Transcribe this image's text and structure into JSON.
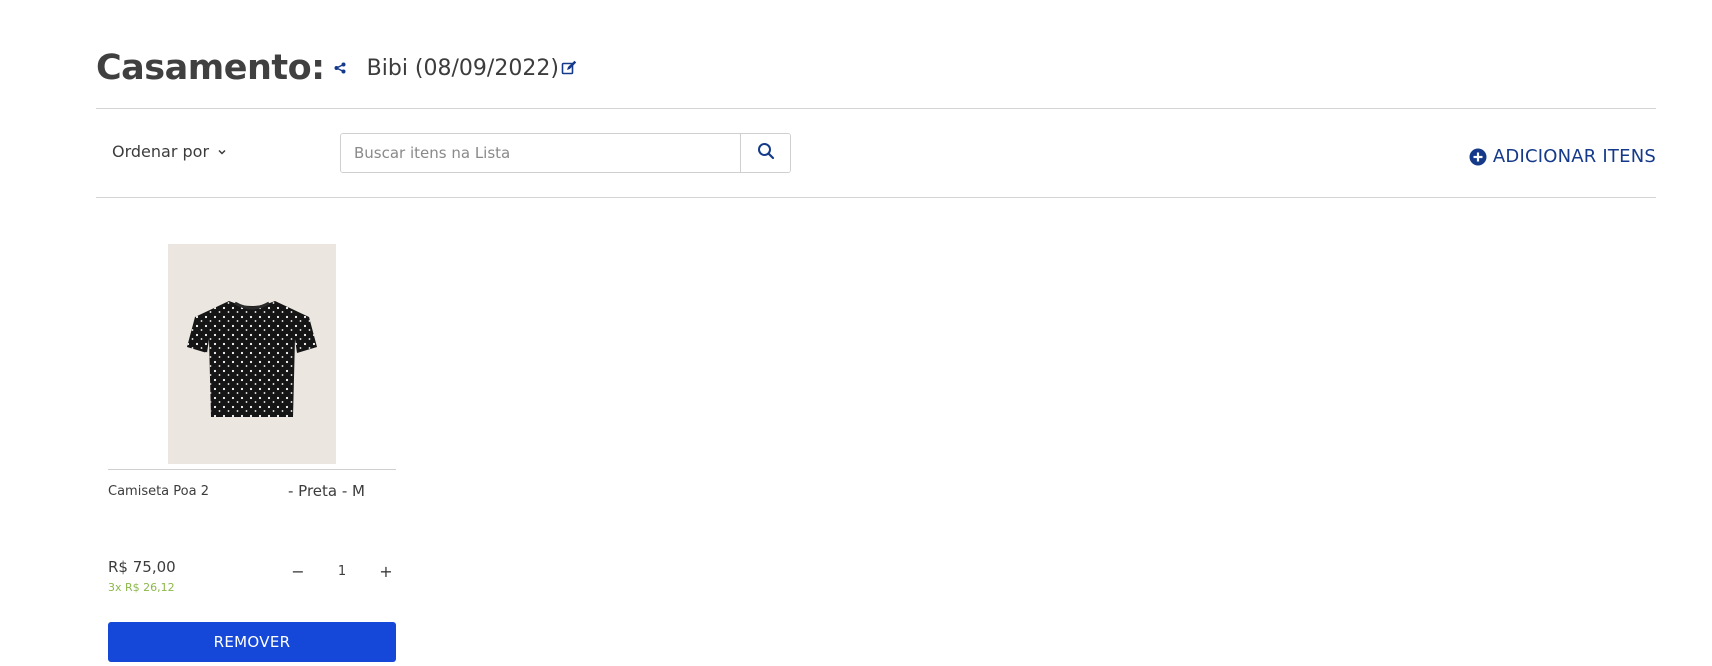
{
  "header": {
    "title": "Casamento:",
    "list_name": "Bibi (08/09/2022)"
  },
  "toolbar": {
    "sort_label": "Ordenar por",
    "search_placeholder": "Buscar itens na Lista",
    "add_items_label": "ADICIONAR ITENS"
  },
  "items": [
    {
      "name": "Camiseta Poa 2",
      "variant": "- Preta - M",
      "price": "R$ 75,00",
      "installments": "3x R$ 26,12",
      "quantity": "1",
      "decrement_label": "−",
      "increment_label": "+",
      "remove_label": "REMOVER"
    }
  ],
  "colors": {
    "accent": "#153a8a",
    "button": "#1548d8",
    "installments": "#8cb84a"
  },
  "icons": [
    "share-icon",
    "edit-icon",
    "chevron-down-icon",
    "search-icon",
    "plus-circle-icon"
  ]
}
